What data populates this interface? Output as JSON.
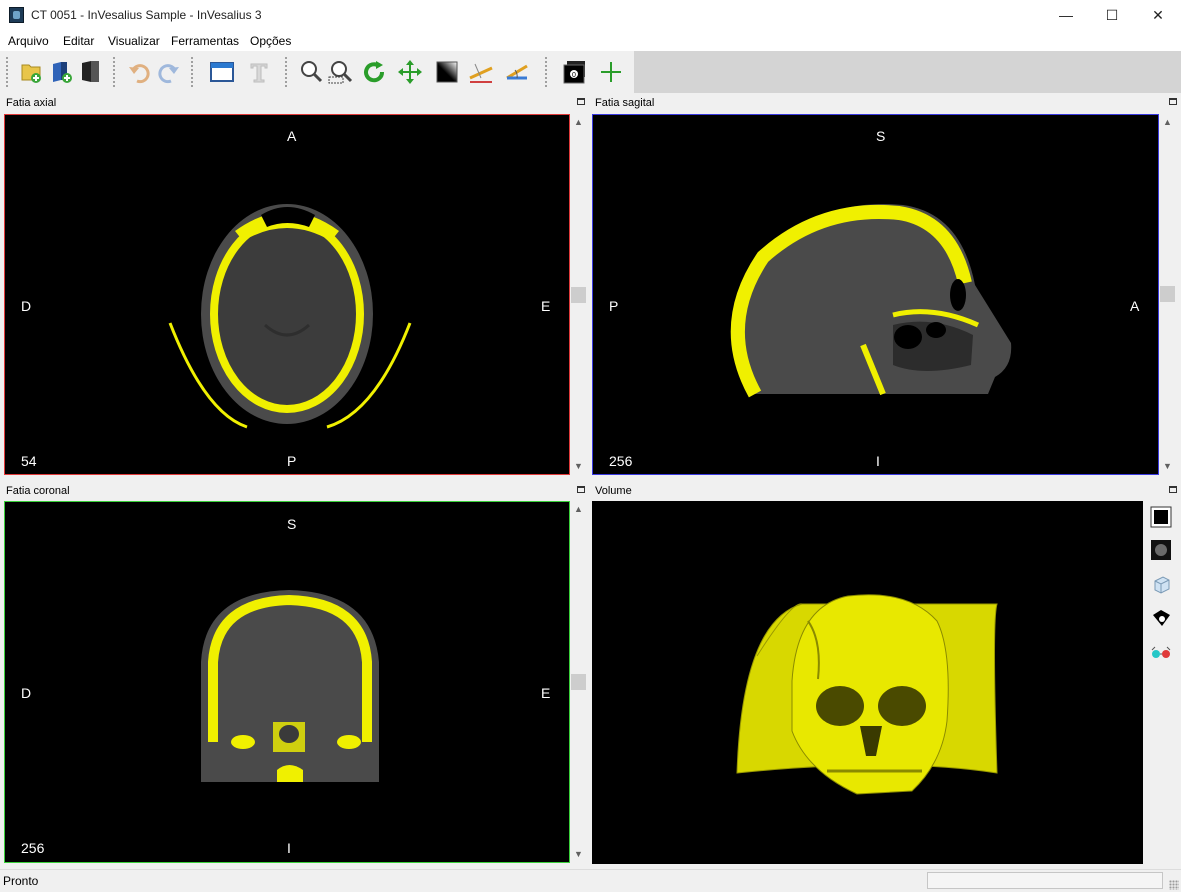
{
  "window": {
    "title": "CT 0051 - InVesalius Sample - InVesalius 3",
    "minimize": "—",
    "maximize": "☐",
    "close": "✕"
  },
  "menu": [
    "Arquivo",
    "Editar",
    "Visualizar",
    "Ferramentas",
    "Opções"
  ],
  "toolbar": {
    "file": [
      "import-icon",
      "open-project-icon",
      "save-project-icon"
    ],
    "history": [
      "undo-icon",
      "redo-icon"
    ],
    "layout": [
      "window-layout-icon",
      "text-icon"
    ],
    "tools": [
      "zoom-icon",
      "zoom-selection-icon",
      "rotate-icon",
      "pan-icon",
      "contrast-icon",
      "measure-linear-icon",
      "measure-angle-icon"
    ],
    "extra": [
      "slice-screenshot-icon",
      "cross-cursor-icon"
    ]
  },
  "panels": {
    "axial": {
      "title": "Fatia axial",
      "top": "A",
      "bottom": "P",
      "left": "D",
      "right": "E",
      "slice": "54",
      "border_color": "#e03a3a"
    },
    "sagittal": {
      "title": "Fatia sagital",
      "top": "S",
      "bottom": "I",
      "left": "P",
      "right": "A",
      "slice": "256",
      "border_color": "#3a3ae0"
    },
    "coronal": {
      "title": "Fatia coronal",
      "top": "S",
      "bottom": "I",
      "left": "D",
      "right": "E",
      "slice": "256",
      "border_color": "#3ad03a"
    },
    "volume": {
      "title": "Volume"
    }
  },
  "volume_tools": [
    "background-color-icon",
    "volume-preset-icon",
    "view-orientation-icon",
    "snapshot-icon",
    "stereo-3d-icon"
  ],
  "colors": {
    "mask": "#f0f000",
    "bone_gray": "#5a5a5a"
  },
  "status": {
    "text": "Pronto"
  }
}
